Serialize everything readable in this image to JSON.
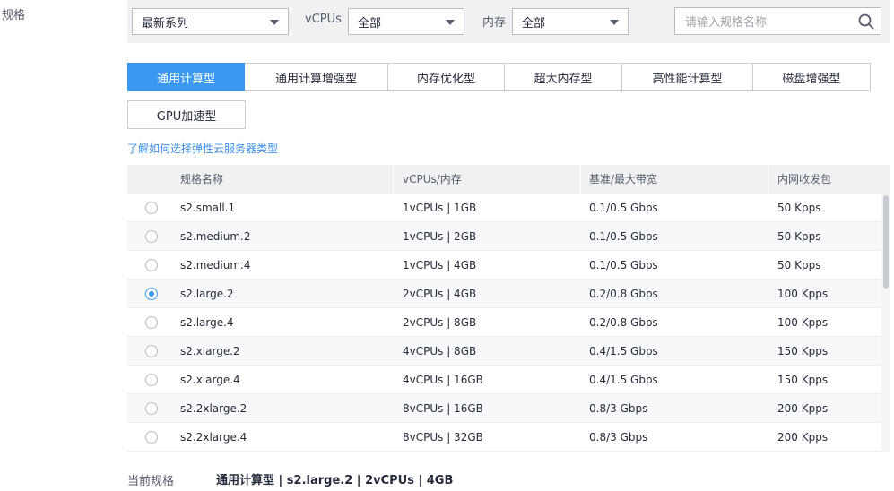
{
  "section_label": "规格",
  "filters": {
    "series": "最新系列",
    "vcpu_label": "vCPUs",
    "vcpu_value": "全部",
    "memory_label": "内存",
    "memory_value": "全部",
    "search_placeholder": "请输入规格名称"
  },
  "tabs": [
    {
      "label": "通用计算型",
      "active": true
    },
    {
      "label": "通用计算增强型",
      "active": false
    },
    {
      "label": "内存优化型",
      "active": false
    },
    {
      "label": "超大内存型",
      "active": false
    },
    {
      "label": "高性能计算型",
      "active": false
    },
    {
      "label": "磁盘增强型",
      "active": false
    },
    {
      "label": "GPU加速型",
      "active": false
    }
  ],
  "help_link": "了解如何选择弹性云服务器类型",
  "table": {
    "headers": [
      "规格名称",
      "vCPUs/内存",
      "基准/最大带宽",
      "内网收发包"
    ],
    "rows": [
      {
        "name": "s2.small.1",
        "cpu_mem": "1vCPUs | 1GB",
        "bandwidth": "0.1/0.5 Gbps",
        "pps": "50 Kpps",
        "selected": false
      },
      {
        "name": "s2.medium.2",
        "cpu_mem": "1vCPUs | 2GB",
        "bandwidth": "0.1/0.5 Gbps",
        "pps": "50 Kpps",
        "selected": false
      },
      {
        "name": "s2.medium.4",
        "cpu_mem": "1vCPUs | 4GB",
        "bandwidth": "0.1/0.5 Gbps",
        "pps": "50 Kpps",
        "selected": false
      },
      {
        "name": "s2.large.2",
        "cpu_mem": "2vCPUs | 4GB",
        "bandwidth": "0.2/0.8 Gbps",
        "pps": "100 Kpps",
        "selected": true
      },
      {
        "name": "s2.large.4",
        "cpu_mem": "2vCPUs | 8GB",
        "bandwidth": "0.2/0.8 Gbps",
        "pps": "100 Kpps",
        "selected": false
      },
      {
        "name": "s2.xlarge.2",
        "cpu_mem": "4vCPUs | 8GB",
        "bandwidth": "0.4/1.5 Gbps",
        "pps": "150 Kpps",
        "selected": false
      },
      {
        "name": "s2.xlarge.4",
        "cpu_mem": "4vCPUs | 16GB",
        "bandwidth": "0.4/1.5 Gbps",
        "pps": "150 Kpps",
        "selected": false
      },
      {
        "name": "s2.2xlarge.2",
        "cpu_mem": "8vCPUs | 16GB",
        "bandwidth": "0.8/3 Gbps",
        "pps": "200 Kpps",
        "selected": false
      },
      {
        "name": "s2.2xlarge.4",
        "cpu_mem": "8vCPUs | 32GB",
        "bandwidth": "0.8/3 Gbps",
        "pps": "200 Kpps",
        "selected": false
      }
    ]
  },
  "current_spec": {
    "label": "当前规格",
    "value": "通用计算型 | s2.large.2 | 2vCPUs | 4GB"
  },
  "colors": {
    "accent": "#3b98f0",
    "link": "#3b8ee6"
  }
}
